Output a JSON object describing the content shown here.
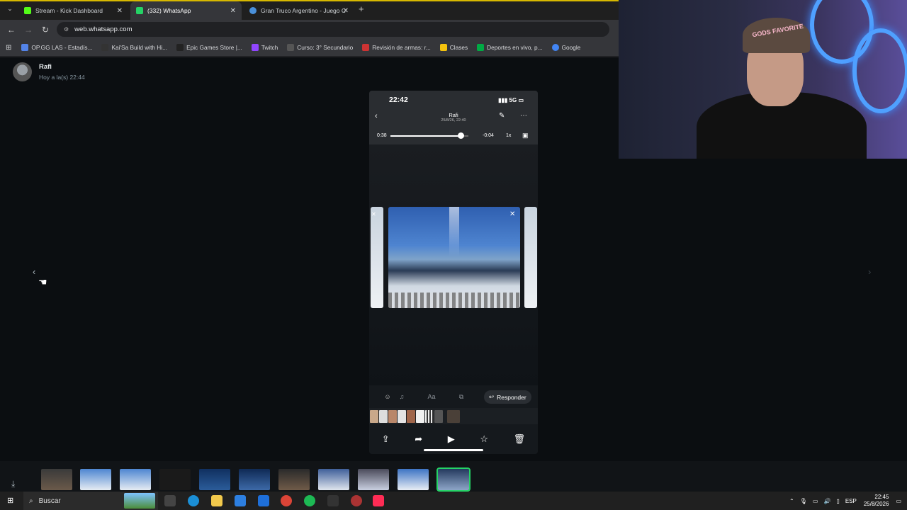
{
  "browser": {
    "tabs": [
      {
        "label": "Stream - Kick Dashboard",
        "color": "#53fc18"
      },
      {
        "label": "(332) WhatsApp",
        "color": "#25d366"
      },
      {
        "label": "Gran Truco Argentino - Juego C",
        "color": "#4a90d9"
      }
    ],
    "url": "web.whatsapp.com",
    "bookmarks": [
      {
        "label": "OP.GG LAS - Estadís...",
        "color": "#5383e8"
      },
      {
        "label": "Kai'Sa Build with Hi...",
        "color": "#333"
      },
      {
        "label": "Epic Games Store |...",
        "color": "#222"
      },
      {
        "label": "Twitch",
        "color": "#9146ff"
      },
      {
        "label": "Curso: 3° Secundario",
        "color": "#555"
      },
      {
        "label": "Revisión de armas: r...",
        "color": "#c33"
      },
      {
        "label": "Clases",
        "color": "#f4c20d"
      },
      {
        "label": "Deportes en vivo, p...",
        "color": "#0a4"
      },
      {
        "label": "Google",
        "color": "#4285f4"
      }
    ]
  },
  "viewer": {
    "sender_name": "Rafi",
    "sender_time": "Hoy a la(s) 22:44"
  },
  "phone": {
    "time": "22:42",
    "network": "5G",
    "contact": "Rafi",
    "date": "25/8/26, 22:40",
    "elapsed": "0:38",
    "remaining": "-0:04",
    "speed": "1x",
    "progress": 0.9,
    "reply_label": "Responder"
  },
  "taskbar": {
    "search_placeholder": "Buscar",
    "lang": "ESP",
    "time": "22:45",
    "date": "25/8/2026"
  },
  "webcam": {
    "cap_text": "GODS FAVORITE"
  }
}
